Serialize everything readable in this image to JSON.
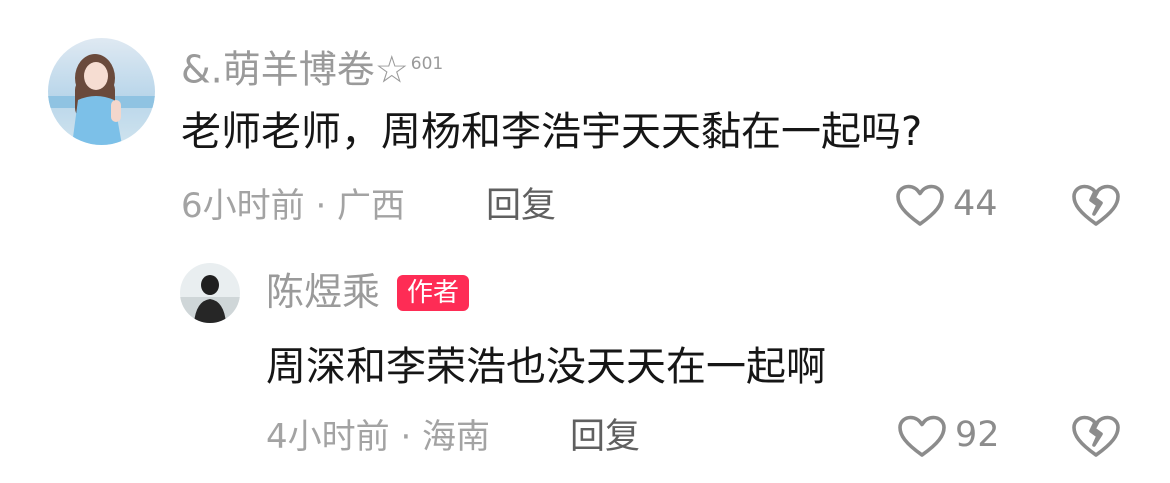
{
  "comments": [
    {
      "username": "&.萌羊博卷☆",
      "level": "601",
      "text": "老师老师，周杨和李浩宇天天黏在一起吗?",
      "meta": "6小时前 · 广西",
      "reply_label": "回复",
      "likes": "44"
    },
    {
      "username": "陈煜乘",
      "badge": "作者",
      "text": "周深和李荣浩也没天天在一起啊",
      "meta": "4小时前 · 海南",
      "reply_label": "回复",
      "likes": "92"
    }
  ],
  "colors": {
    "author_badge": "#fe2c55",
    "username": "#9a9a9a",
    "text": "#161616"
  },
  "icons": [
    "heart-outline-icon",
    "broken-heart-icon"
  ]
}
